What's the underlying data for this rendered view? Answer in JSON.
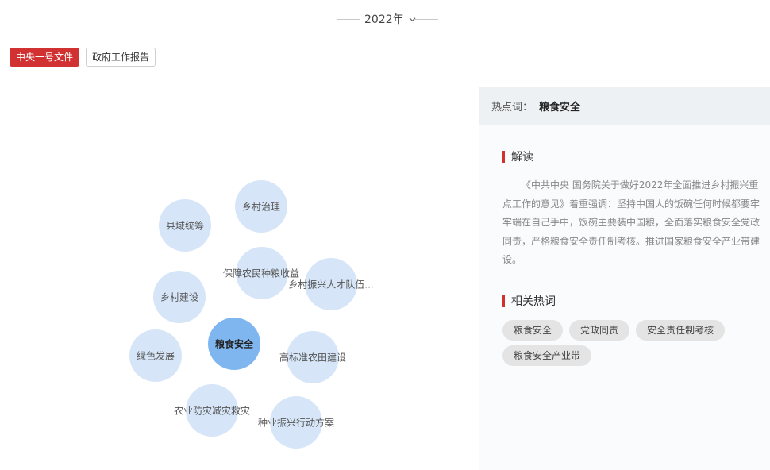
{
  "year": {
    "label": "2022年",
    "icon": "chevron-down-icon"
  },
  "tabs": [
    {
      "label": "中央一号文件",
      "active": true
    },
    {
      "label": "政府工作报告",
      "active": false
    }
  ],
  "bubbles": {
    "main": "粮食安全",
    "items": [
      "乡村治理",
      "县域统筹",
      "保障农民种粮收益",
      "乡村振兴人才队伍...",
      "乡村建设",
      "绿色发展",
      "高标准农田建设",
      "农业防灾减灾救灾",
      "种业振兴行动方案"
    ]
  },
  "panel": {
    "header_label": "热点词：",
    "header_keyword": "粮食安全",
    "interpret_title": "解读",
    "interpret_text": "《中共中央 国务院关于做好2022年全面推进乡村振兴重点工作的意见》着重强调：坚持中国人的饭碗任何时候都要牢牢端在自己手中，饭碗主要装中国粮，全面落实粮食安全党政同责，严格粮食安全责任制考核。推进国家粮食安全产业带建设。",
    "related_title": "相关热词",
    "related_tags": [
      "粮食安全",
      "党政同责",
      "安全责任制考核",
      "粮食安全产业带"
    ]
  },
  "colors": {
    "accent": "#d23131",
    "bubble": "#d6e6f8",
    "bubble_main": "#80b6f0"
  }
}
